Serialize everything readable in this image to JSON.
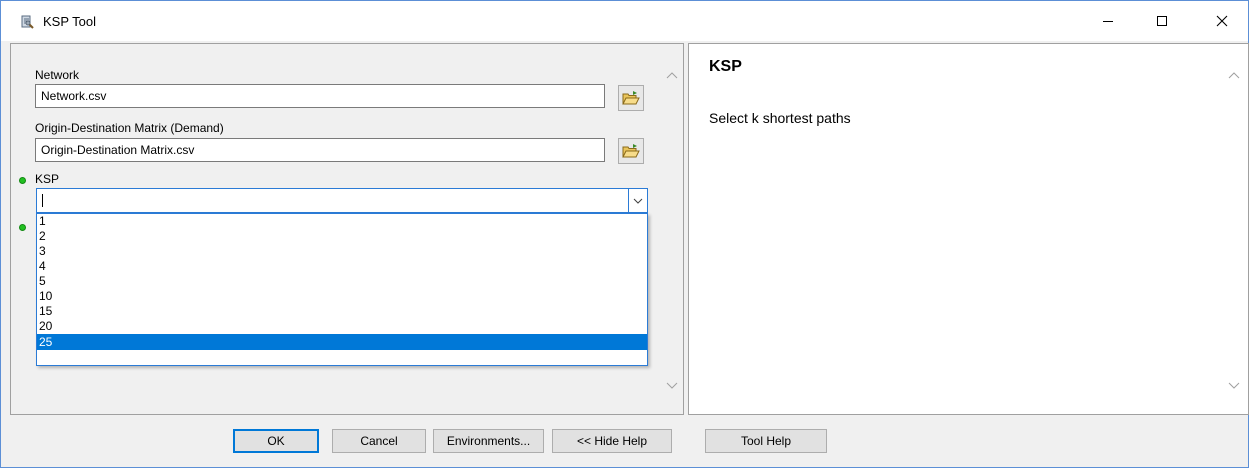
{
  "window": {
    "title": "KSP Tool",
    "icons": {
      "app": "tool-app-icon",
      "minimize": "minimize-icon",
      "maximize": "maximize-icon",
      "close": "close-icon"
    }
  },
  "form": {
    "network": {
      "label": "Network",
      "value": "Network.csv",
      "button_icon": "open-folder-icon"
    },
    "od_matrix": {
      "label": "Origin-Destination Matrix (Demand)",
      "value": "Origin-Destination Matrix.csv",
      "button_icon": "open-folder-icon"
    },
    "ksp": {
      "label": "KSP",
      "value": "",
      "required_indicator": "green-dot",
      "options": [
        "1",
        "2",
        "3",
        "4",
        "5",
        "10",
        "15",
        "20",
        "25"
      ],
      "highlighted_option": "25"
    }
  },
  "help": {
    "title": "KSP",
    "text": "Select k shortest paths"
  },
  "buttons": {
    "ok": "OK",
    "cancel": "Cancel",
    "environments": "Environments...",
    "hide_help": "<< Hide Help",
    "tool_help": "Tool Help"
  },
  "colors": {
    "accent": "#0078d7",
    "required_dot": "#22c022",
    "window_border": "#5c8fd6"
  }
}
